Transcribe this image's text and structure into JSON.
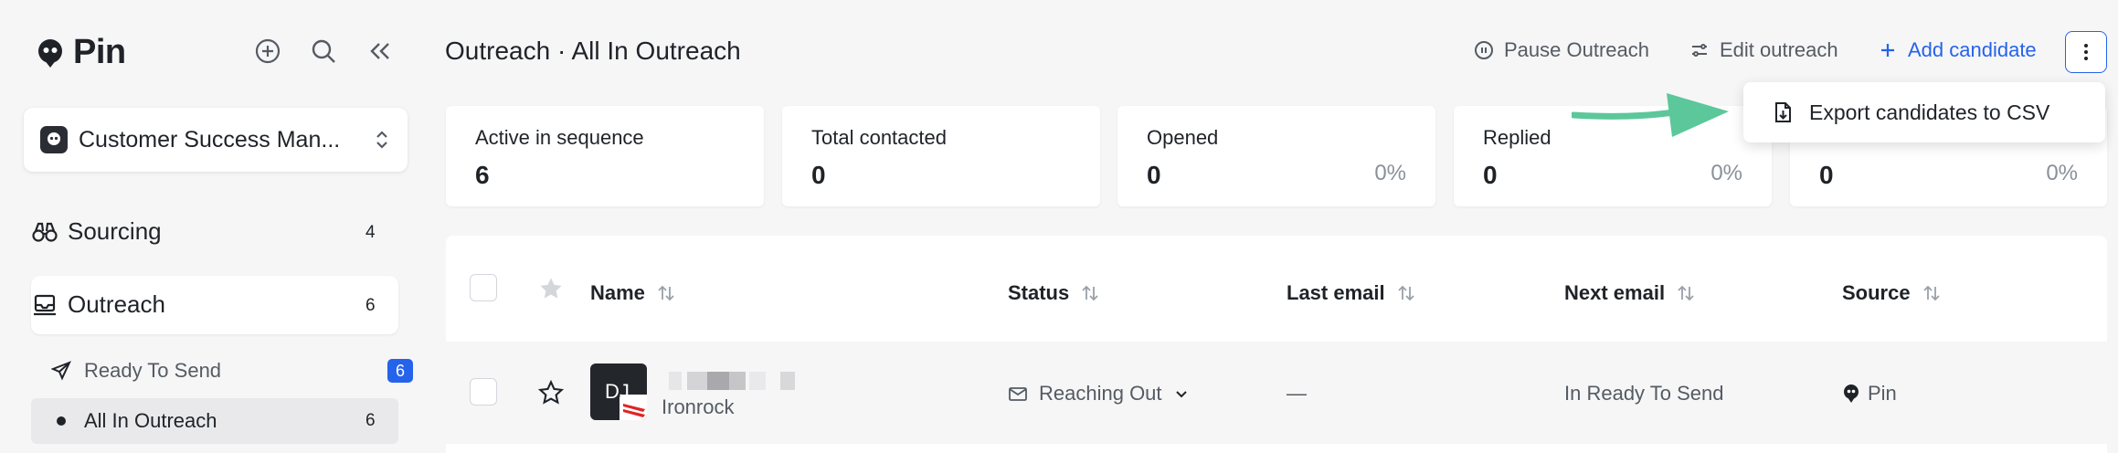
{
  "app": {
    "name": "Pin"
  },
  "workspace": {
    "name": "Customer Success Man..."
  },
  "sidebar": {
    "items": [
      {
        "label": "Sourcing",
        "count": "4",
        "icon": "binoculars-icon"
      },
      {
        "label": "Outreach",
        "count": "6",
        "icon": "inbox-icon"
      }
    ],
    "sub_items": [
      {
        "label": "Ready To Send",
        "count": "6",
        "icon": "send-icon"
      },
      {
        "label": "All In Outreach",
        "count": "6",
        "icon": "dot-icon"
      }
    ]
  },
  "header": {
    "title": "Outreach · All In Outreach",
    "pause_label": "Pause Outreach",
    "edit_label": "Edit outreach",
    "add_label": "Add candidate",
    "accent": "#2563eb"
  },
  "dropdown": {
    "export_label": "Export candidates to CSV"
  },
  "stats": [
    {
      "label": "Active in sequence",
      "value": "6",
      "pct": ""
    },
    {
      "label": "Total contacted",
      "value": "0",
      "pct": ""
    },
    {
      "label": "Opened",
      "value": "0",
      "pct": "0%"
    },
    {
      "label": "Replied",
      "value": "0",
      "pct": "0%"
    },
    {
      "label": "",
      "value": "0",
      "pct": "0%"
    }
  ],
  "table": {
    "columns": [
      "Name",
      "Status",
      "Last email",
      "Next email",
      "Source"
    ],
    "rows": [
      {
        "initials": "DJ",
        "company": "Ironrock",
        "status": "Reaching Out",
        "last_email": "—",
        "next_email": "In Ready To Send",
        "source": "Pin"
      }
    ]
  },
  "colors": {
    "arrow": "#5cc79a",
    "badge": "#2563eb"
  }
}
